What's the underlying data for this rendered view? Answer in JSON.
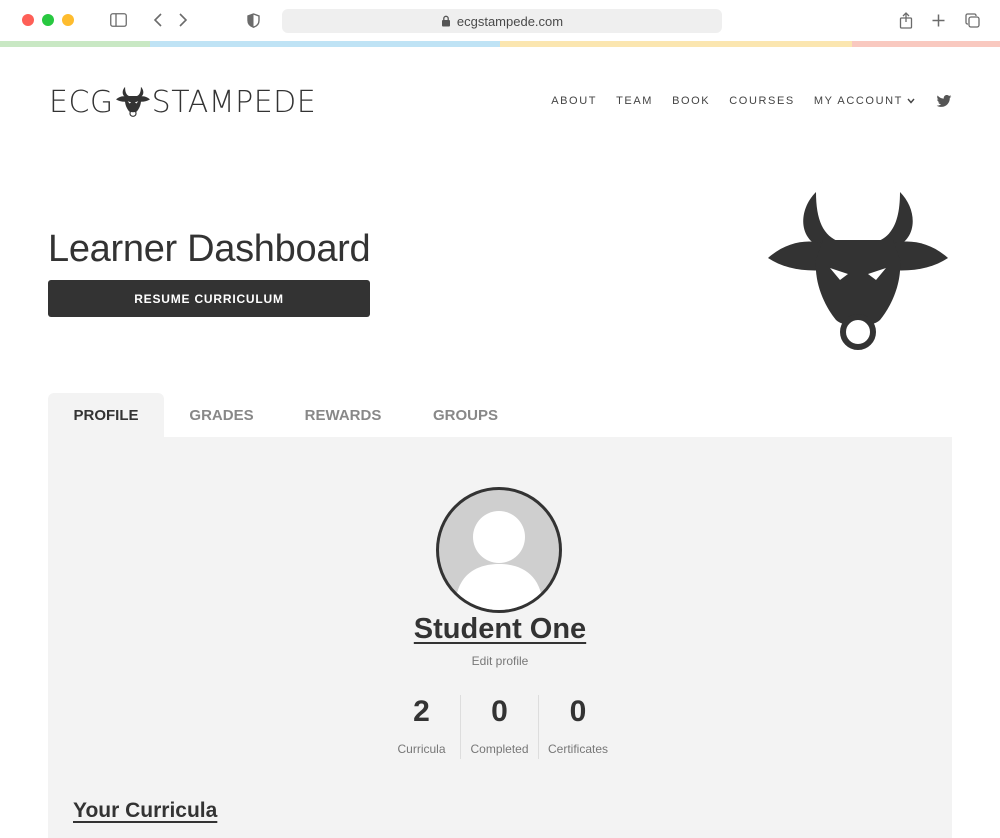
{
  "browser": {
    "url": "ecgstampede.com",
    "strip_colors": [
      "#c9e8c4",
      "#bfe3f5",
      "#fbe6b0",
      "#f9c9c0"
    ]
  },
  "site": {
    "logo_left": "ECG",
    "logo_right": "STAMPEDE",
    "nav": {
      "about": "ABOUT",
      "team": "TEAM",
      "book": "BOOK",
      "courses": "COURSES",
      "my_account": "MY ACCOUNT"
    }
  },
  "dashboard": {
    "title": "Learner Dashboard",
    "resume_label": "RESUME CURRICULUM",
    "tabs": {
      "profile": "PROFILE",
      "grades": "GRADES",
      "rewards": "REWARDS",
      "groups": "GROUPS"
    }
  },
  "profile": {
    "name": "Student One",
    "edit_label": "Edit profile",
    "stats": [
      {
        "value": "2",
        "label": "Curricula"
      },
      {
        "value": "0",
        "label": "Completed"
      },
      {
        "value": "0",
        "label": "Certificates"
      }
    ],
    "curricula_heading": "Your Curricula"
  },
  "colors": {
    "primary_dark": "#333333",
    "panel_bg": "#f3f3f3",
    "muted_text": "#888888"
  }
}
